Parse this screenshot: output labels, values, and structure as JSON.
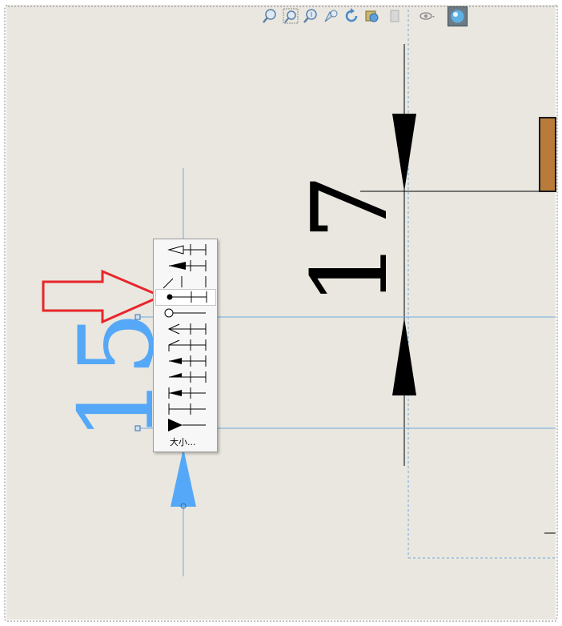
{
  "window": {
    "background": "#e9e7df",
    "frame_color": "#a8a8a8"
  },
  "toolbar": {
    "icons": [
      "zoom-to-fit-icon",
      "zoom-to-area-icon",
      "zoom-in-out-icon",
      "zoom-to-selection-icon",
      "rotate-view-icon",
      "pan-view-icon",
      "display-style-icon",
      "hide-show-items-icon",
      "appearance-icon"
    ]
  },
  "drawing": {
    "dimension_black": {
      "value": "17",
      "color": "#000000"
    },
    "dimension_blue": {
      "value": "15",
      "color": "#55a8f7"
    },
    "orange_part_color": "#b87b3a",
    "line_blue": "#6fa8e0"
  },
  "arrow_popup": {
    "options": [
      "open-arrow-outline",
      "closed-filled-arrow",
      "slash-tick",
      "filled-dot",
      "open-circle",
      "open-arrow-thin",
      "open-arrow-half",
      "filled-arrow-small",
      "filled-arrow-half",
      "no-terminator",
      "filled-triangle-large"
    ],
    "selected": "filled-dot",
    "size_label": "大小..."
  },
  "annotation": {
    "pointer_color": "#e8262b",
    "pointer_icon": "red-outline-arrow-icon"
  }
}
